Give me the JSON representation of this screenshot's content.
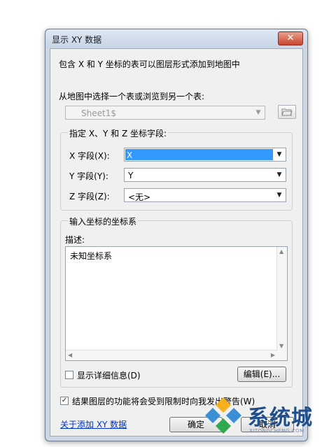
{
  "window": {
    "title": "显示 XY 数据",
    "close_glyph": "✕"
  },
  "description": "包含 X 和 Y 坐标的表可以图层形式添加到地图中",
  "table_select": {
    "label": "从地图中选择一个表或浏览到另一个表:",
    "value": "Sheet1$",
    "browse_icon": "folder-open-icon"
  },
  "fields_group": {
    "title": "指定 X、Y 和 Z 坐标字段:",
    "x": {
      "label": "X 字段(X):",
      "value": "X"
    },
    "y": {
      "label": "Y 字段(Y):",
      "value": "Y"
    },
    "z": {
      "label": "Z 字段(Z):",
      "value": "<无>"
    }
  },
  "coord_group": {
    "title": "输入坐标的坐标系",
    "desc_label": "描述:",
    "desc_value": "未知坐标系",
    "show_details_label": "显示详细信息(D)",
    "show_details_checked": false,
    "edit_button": "编辑(E)..."
  },
  "warning": {
    "label": "结果图层的功能将会受到限制时向我发出警告(W)",
    "checked": true
  },
  "about_link": "关于添加 XY 数据",
  "buttons": {
    "ok": "确定",
    "cancel": "取消"
  },
  "watermark": {
    "text": "系统城",
    "url": "XITONGCHENG.COM"
  },
  "colors": {
    "selection": "#3399ff",
    "link": "#0033cc",
    "titlebar": "#c7d5e6"
  }
}
